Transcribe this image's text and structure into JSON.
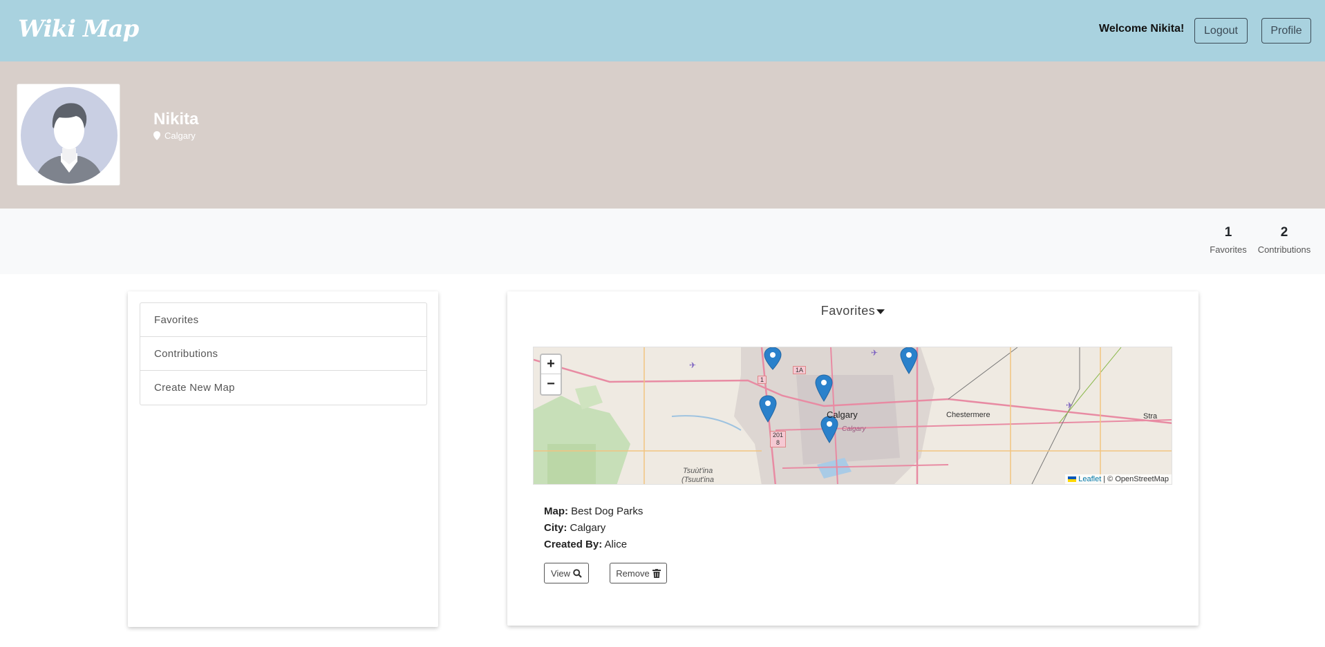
{
  "navbar": {
    "brand": "Wiki Map",
    "welcome": "Welcome Nikita!",
    "logout_label": "Logout",
    "profile_label": "Profile"
  },
  "profile": {
    "name": "Nikita",
    "location": "Calgary"
  },
  "stats": {
    "favorites_count": "1",
    "favorites_label": "Favorites",
    "contributions_count": "2",
    "contributions_label": "Contributions"
  },
  "sidebar": {
    "items": [
      {
        "label": "Favorites"
      },
      {
        "label": "Contributions"
      },
      {
        "label": "Create New Map"
      }
    ]
  },
  "main": {
    "title": "Favorites",
    "map": {
      "zoom_in": "+",
      "zoom_out": "−",
      "attribution_leaflet": "Leaflet",
      "attribution_rest": "| © OpenStreetMap",
      "labels": {
        "calgary": "Calgary",
        "calgary_small": "Calgary",
        "chestermere": "Chestermere",
        "strathmore": "Stra",
        "tsuutina_1": "Tsuùt'ina",
        "tsuutina_2": "(Tsuut'ina",
        "hwy_1": "1",
        "hwy_1a": "1A",
        "hwy_201_a": "201",
        "hwy_201_b": "8"
      }
    },
    "details": {
      "map_label": "Map:",
      "map_value": "Best Dog Parks",
      "city_label": "City:",
      "city_value": "Calgary",
      "created_label": "Created By:",
      "created_value": "Alice"
    },
    "view_label": "View",
    "remove_label": "Remove"
  }
}
